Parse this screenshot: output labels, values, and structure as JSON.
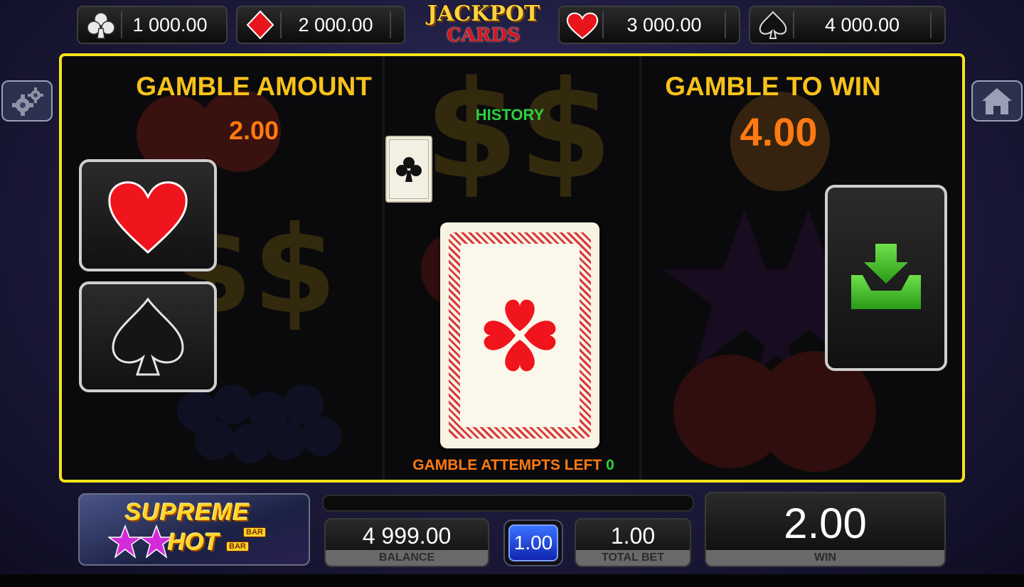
{
  "jackpots": [
    {
      "suit": "club-icon",
      "value": "1 000.00"
    },
    {
      "suit": "diamond-icon",
      "value": "2 000.00"
    },
    {
      "suit": "heart-icon",
      "value": "3 000.00"
    },
    {
      "suit": "spade-icon",
      "value": "4 000.00"
    }
  ],
  "logo": {
    "line1": "JACKPOT",
    "line2": "CARDS"
  },
  "gamble": {
    "amount_label": "GAMBLE AMOUNT",
    "amount_value": "2.00",
    "to_win_label": "GAMBLE TO WIN",
    "to_win_value": "4.00",
    "history_label": "HISTORY",
    "attempts_label": "GAMBLE ATTEMPTS LEFT",
    "attempts_value": "0"
  },
  "game": {
    "title_line1": "SUPREME",
    "title_line2": "HOT",
    "bar_tag": "BAR"
  },
  "bottom": {
    "balance_value": "4 999.00",
    "balance_label": "BALANCE",
    "bet_value": "1.00",
    "total_bet_value": "1.00",
    "total_bet_label": "TOTAL BET",
    "win_value": "2.00",
    "win_label": "WIN"
  },
  "colors": {
    "panel_border": "#f5e41a",
    "orange": "#ff7a12",
    "gold": "#f7c21a",
    "green": "#2bd13b",
    "red": "#e8141c"
  }
}
